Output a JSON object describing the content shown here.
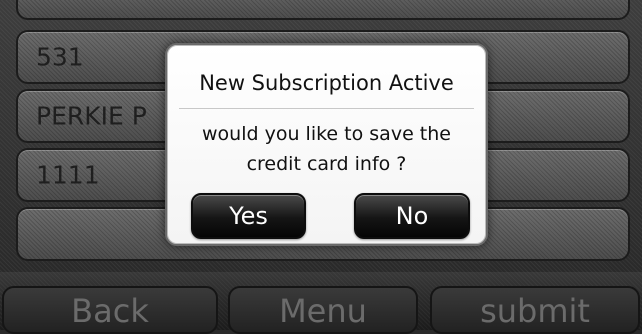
{
  "form": {
    "fields": [
      {
        "value": ""
      },
      {
        "value": "531"
      },
      {
        "value": "PERKIE P"
      },
      {
        "value": "1111"
      },
      {
        "value": ""
      }
    ]
  },
  "bottom_bar": {
    "back_label": "Back",
    "menu_label": "Menu",
    "submit_label": "submit"
  },
  "dialog": {
    "title": "New Subscription Active",
    "message": "would you like to save the credit card info ?",
    "yes_label": "Yes",
    "no_label": "No"
  }
}
